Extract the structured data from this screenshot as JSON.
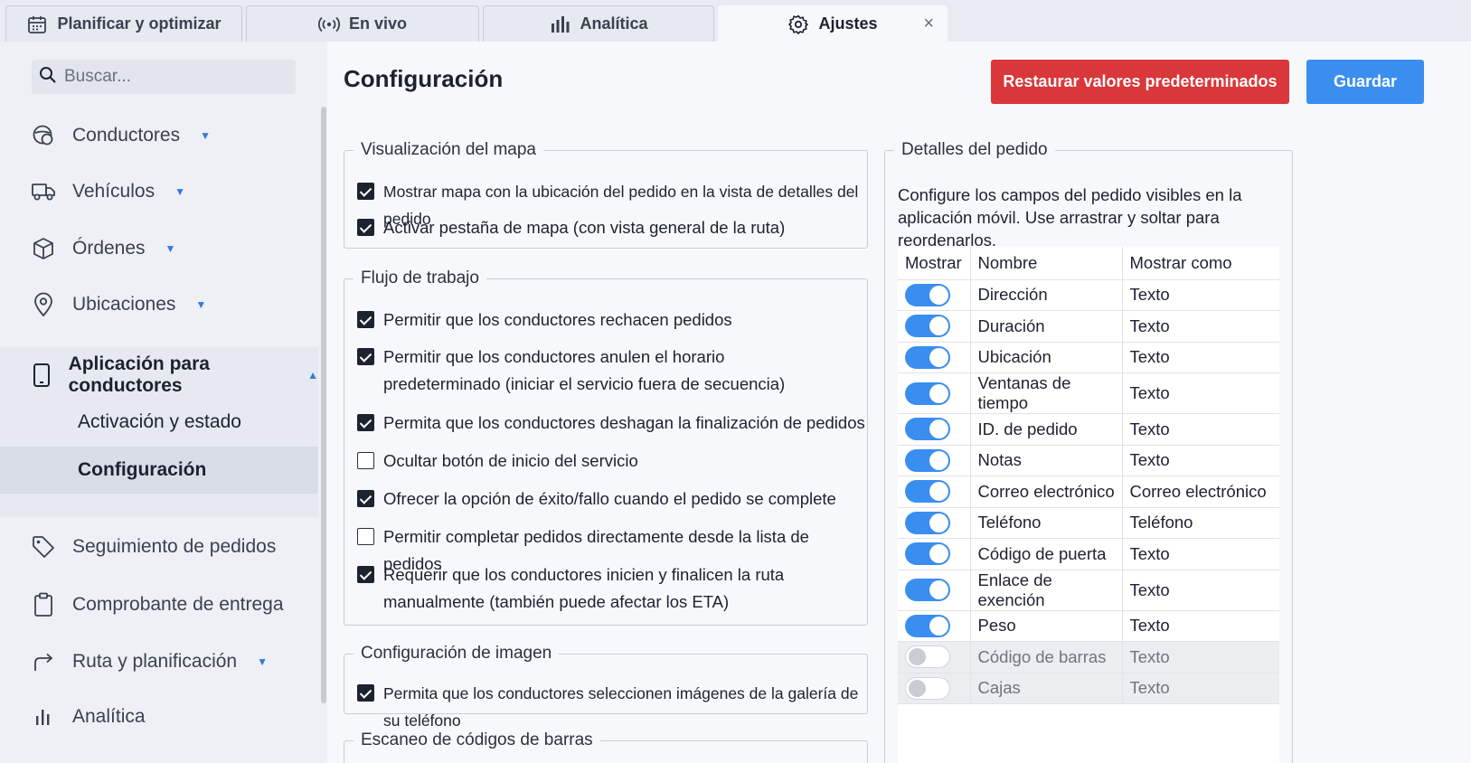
{
  "tabs": [
    {
      "label": "Planificar y optimizar",
      "icon": "calendar-icon"
    },
    {
      "label": "En vivo",
      "icon": "broadcast-icon"
    },
    {
      "label": "Analítica",
      "icon": "bar-chart-icon"
    },
    {
      "label": "Ajustes",
      "icon": "gear-icon",
      "active": true,
      "close": "×"
    }
  ],
  "search": {
    "placeholder": "Buscar..."
  },
  "sidebar": {
    "items": [
      {
        "label": "Conductores",
        "icon": "steering-icon"
      },
      {
        "label": "Vehículos",
        "icon": "truck-icon"
      },
      {
        "label": "Órdenes",
        "icon": "box-icon"
      },
      {
        "label": "Ubicaciones",
        "icon": "pin-icon"
      },
      {
        "label": "Aplicación para conductores",
        "icon": "phone-icon"
      },
      {
        "label": "Seguimiento de pedidos",
        "icon": "tag-icon"
      },
      {
        "label": "Comprobante de entrega",
        "icon": "clipboard-icon"
      },
      {
        "label": "Ruta y planificación",
        "icon": "route-icon"
      },
      {
        "label": "Analítica",
        "icon": "bar-chart-icon"
      }
    ],
    "sub_items": [
      "Activación y estado",
      "Configuración"
    ]
  },
  "main": {
    "title": "Configuración",
    "restore_label": "Restaurar valores predeterminados",
    "save_label": "Guardar",
    "map_section": {
      "legend": "Visualización del mapa",
      "options": [
        {
          "label": "Mostrar mapa con la ubicación del pedido en la vista de detalles del pedido",
          "checked": true
        },
        {
          "label": "Activar pestaña de mapa (con vista general de la ruta)",
          "checked": true
        }
      ]
    },
    "workflow_section": {
      "legend": "Flujo de trabajo",
      "options": [
        {
          "label": "Permitir que los conductores rechacen pedidos",
          "checked": true
        },
        {
          "label": "Permitir que los conductores anulen el horario predeterminado (iniciar el servicio fuera de secuencia)",
          "checked": true
        },
        {
          "label": "Permita que los conductores deshagan la finalización de pedidos",
          "checked": true
        },
        {
          "label": "Ocultar botón de inicio del servicio",
          "checked": false
        },
        {
          "label": "Ofrecer la opción de éxito/fallo cuando el pedido se complete",
          "checked": true
        },
        {
          "label": "Permitir completar pedidos directamente desde la lista de pedidos",
          "checked": false
        },
        {
          "label": "Requerir que los conductores inicien y finalicen la ruta manualmente (también puede afectar los ETA)",
          "checked": true
        }
      ]
    },
    "image_section": {
      "legend": "Configuración de imagen",
      "options": [
        {
          "label": "Permita que los conductores seleccionen imágenes de la galería de su teléfono",
          "checked": true
        }
      ]
    },
    "barcode_section": {
      "legend": "Escaneo de códigos de barras"
    },
    "order_details": {
      "legend": "Detalles del pedido",
      "description": "Configure los campos del pedido visibles en la aplicación móvil. Use arrastrar y soltar para reordenarlos.",
      "columns": [
        "Mostrar",
        "Nombre",
        "Mostrar como"
      ],
      "rows": [
        {
          "show": true,
          "name": "Dirección",
          "as": "Texto"
        },
        {
          "show": true,
          "name": "Duración",
          "as": "Texto"
        },
        {
          "show": true,
          "name": "Ubicación",
          "as": "Texto"
        },
        {
          "show": true,
          "name": "Ventanas de tiempo",
          "as": "Texto"
        },
        {
          "show": true,
          "name": "ID. de pedido",
          "as": "Texto"
        },
        {
          "show": true,
          "name": "Notas",
          "as": "Texto"
        },
        {
          "show": true,
          "name": "Correo electrónico",
          "as": "Correo electrónico"
        },
        {
          "show": true,
          "name": "Teléfono",
          "as": "Teléfono"
        },
        {
          "show": true,
          "name": "Código de puerta",
          "as": "Texto"
        },
        {
          "show": true,
          "name": "Enlace de exención",
          "as": "Texto"
        },
        {
          "show": true,
          "name": "Peso",
          "as": "Texto"
        },
        {
          "show": false,
          "name": "Código de barras",
          "as": "Texto"
        },
        {
          "show": false,
          "name": "Cajas",
          "as": "Texto"
        }
      ]
    }
  },
  "colors": {
    "accent": "#3a8eef",
    "danger": "#d9373a",
    "caret": "#3677e0"
  }
}
